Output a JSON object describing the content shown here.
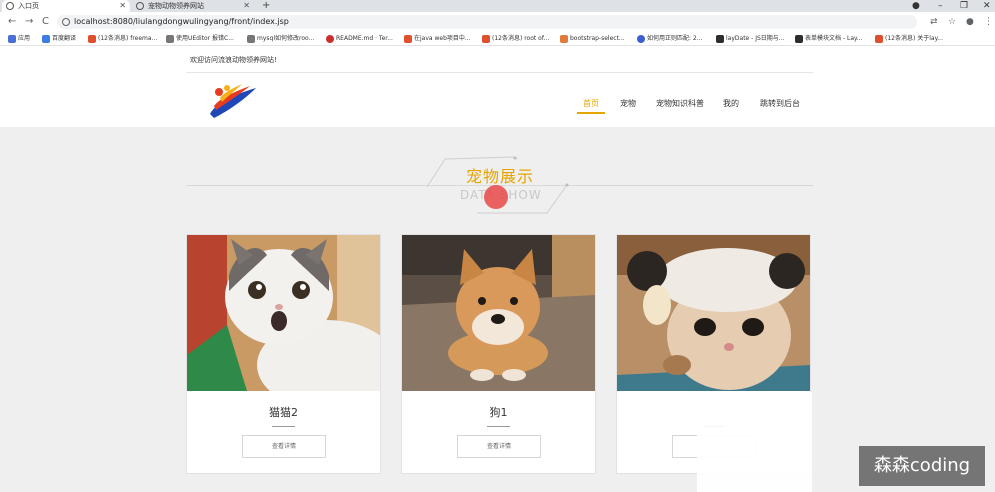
{
  "browser": {
    "tabs": [
      {
        "label": "入口页",
        "active": true
      },
      {
        "label": "宠物动物领养网站",
        "active": false
      }
    ],
    "url": "localhost:8080/liulangdongwulingyang/front/index.jsp",
    "bookmarks": [
      "应用",
      "百度翻译",
      "(12条消息) freema...",
      "使用UEditor 报错C...",
      "mysql如何修改roo...",
      "README.md · Ter...",
      "在java web项目中...",
      "(12条消息) root of...",
      "bootstrap-select...",
      "如何用正则匹配: 2...",
      "layDate - JS日期与...",
      "表单模块文档 - Lay...",
      "(12条消息) 关于lay..."
    ]
  },
  "header": {
    "welcome": "欢迎访问流浪动物领养网站!",
    "nav": [
      "首页",
      "宠物",
      "宠物知识科普",
      "我的",
      "跳转到后台"
    ]
  },
  "section": {
    "title_cn": "宠物展示",
    "title_en": "DATA SHOW"
  },
  "cards": [
    {
      "name": "猫猫2",
      "button": "查看详情"
    },
    {
      "name": "狗1",
      "button": "查看详情"
    },
    {
      "name": "",
      "button": ""
    }
  ],
  "watermark": "森森coding",
  "colors": {
    "accent": "#e6a400",
    "page_bg": "#efefef"
  }
}
